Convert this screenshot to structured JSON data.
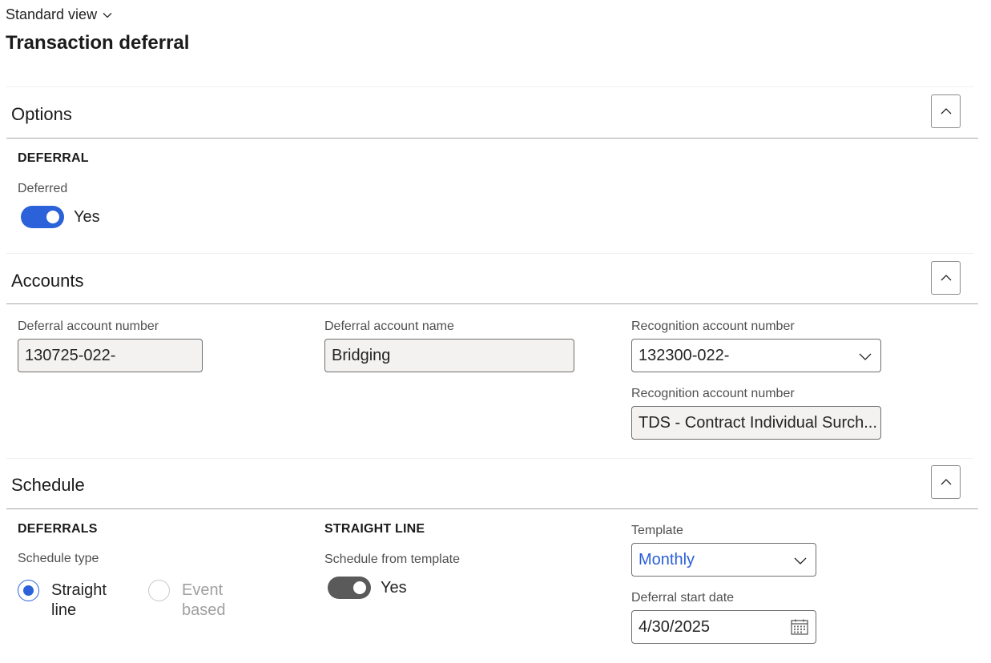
{
  "header": {
    "view_label": "Standard view",
    "page_title": "Transaction deferral"
  },
  "options": {
    "title": "Options",
    "group_label": "DEFERRAL",
    "deferred_label": "Deferred",
    "deferred_value": "Yes"
  },
  "accounts": {
    "title": "Accounts",
    "deferral_account_number_label": "Deferral account number",
    "deferral_account_number_value": "130725-022-",
    "deferral_account_name_label": "Deferral account name",
    "deferral_account_name_value": "Bridging",
    "recognition_account_number_label": "Recognition account number",
    "recognition_account_number_value": "132300-022-",
    "recognition_account_name_label": "Recognition account number",
    "recognition_account_name_value": "TDS - Contract Individual Surch..."
  },
  "schedule": {
    "title": "Schedule",
    "deferrals_group_label": "DEFERRALS",
    "schedule_type_label": "Schedule type",
    "schedule_type_options": [
      {
        "label_line1": "Straight",
        "label_line2": "line",
        "selected": true
      },
      {
        "label_line1": "Event",
        "label_line2": "based",
        "selected": false
      }
    ],
    "straight_line_group_label": "STRAIGHT LINE",
    "schedule_from_template_label": "Schedule from template",
    "schedule_from_template_value": "Yes",
    "template_label": "Template",
    "template_value": "Monthly",
    "deferral_start_date_label": "Deferral start date",
    "deferral_start_date_value": "4/30/2025"
  },
  "colors": {
    "accent": "#2b61d9",
    "toggle_off_gray": "#5a5a5a",
    "readonly_field_bg": "#f3f2f1"
  },
  "icons": {
    "view_chevron": "chevron-down-icon",
    "collapse": "chevron-up-icon",
    "dropdown": "chevron-down-icon",
    "calendar": "calendar-icon"
  }
}
